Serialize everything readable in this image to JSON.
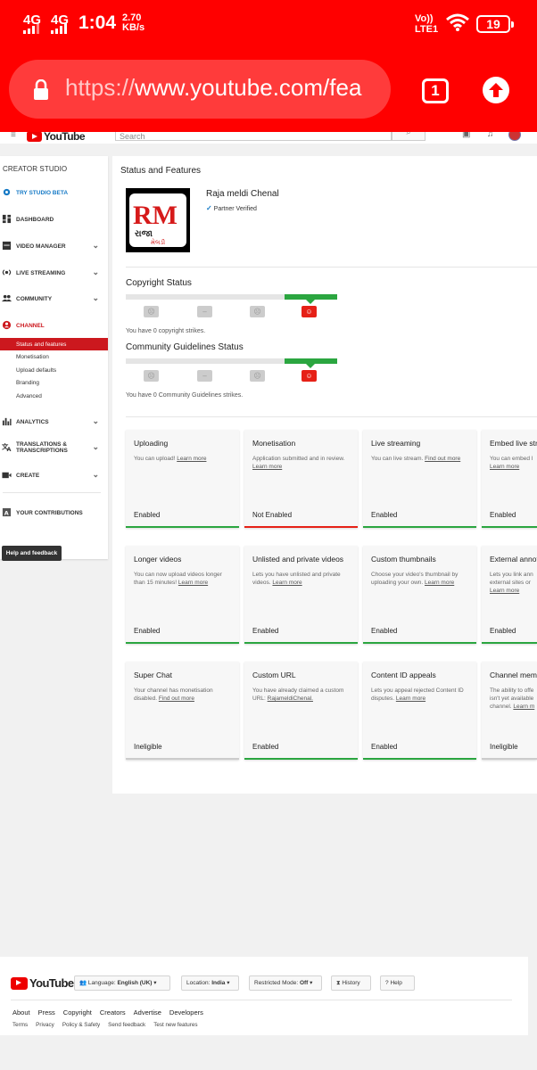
{
  "statusbar": {
    "net1": "4G",
    "net2": "4G",
    "time": "1:04",
    "speed_value": "2.70",
    "speed_unit": "KB/s",
    "volte": "Vo))",
    "lte": "LTE1",
    "battery": "19"
  },
  "browser": {
    "url_scheme": "https://",
    "url_rest": "www.youtube.com/fea",
    "tab_count": "1"
  },
  "header": {
    "logo": "YouTube",
    "search_placeholder": "Search"
  },
  "sidebar": {
    "title": "CREATOR STUDIO",
    "items": [
      {
        "label": "TRY STUDIO BETA",
        "icon": "gear-icon"
      },
      {
        "label": "DASHBOARD",
        "icon": "dashboard-icon"
      },
      {
        "label": "VIDEO MANAGER",
        "icon": "video-manager-icon"
      },
      {
        "label": "LIVE STREAMING",
        "icon": "live-icon"
      },
      {
        "label": "COMMUNITY",
        "icon": "people-icon"
      },
      {
        "label": "CHANNEL",
        "icon": "channel-icon"
      },
      {
        "label": "ANALYTICS",
        "icon": "analytics-icon"
      },
      {
        "label": "TRANSLATIONS &",
        "label2": "TRANSCRIPTIONS",
        "icon": "translate-icon"
      },
      {
        "label": "CREATE",
        "icon": "create-icon"
      },
      {
        "label": "YOUR CONTRIBUTIONS",
        "icon": "contributions-icon"
      }
    ],
    "channel_sub": [
      "Status and features",
      "Monetisation",
      "Upload defaults",
      "Branding",
      "Advanced"
    ],
    "help_button": "Help and feedback"
  },
  "main": {
    "title": "Status and Features",
    "channel_name": "Raja meldi Chenal",
    "partner": "Partner Verified",
    "logo_text": "RM",
    "logo_sub": "રાજા",
    "logo_sub2": "મેલડી",
    "copyright_title": "Copyright Status",
    "copyright_strikes": "You have 0 copyright strikes.",
    "guidelines_title": "Community Guidelines Status",
    "guidelines_strikes": "You have 0 Community Guidelines strikes.",
    "cards": [
      {
        "title": "Uploading",
        "desc": "You can upload!",
        "link": "Learn more",
        "status": "Enabled",
        "bar": "green"
      },
      {
        "title": "Monetisation",
        "desc": "Application submitted and in review.",
        "link": "Learn more",
        "status": "Not Enabled",
        "bar": "red"
      },
      {
        "title": "Live streaming",
        "desc": "You can live stream.",
        "link": "Find out more",
        "status": "Enabled",
        "bar": "green"
      },
      {
        "title": "Embed live stre",
        "desc": "You can embed l",
        "link": "Learn more",
        "status": "Enabled",
        "bar": "green"
      },
      {
        "title": "Longer videos",
        "desc": "You can now upload videos longer than 15 minutes!",
        "link": "Learn more",
        "status": "Enabled",
        "bar": "green"
      },
      {
        "title": "Unlisted and private videos",
        "desc": "Lets you have unlisted and private videos.",
        "link": "Learn more",
        "status": "Enabled",
        "bar": "green"
      },
      {
        "title": "Custom thumbnails",
        "desc": "Choose your video's thumbnail by uploading your own.",
        "link": "Learn more",
        "status": "Enabled",
        "bar": "green"
      },
      {
        "title": "External annot",
        "desc": "Lets you link ann external sites or",
        "link": "Learn more",
        "status": "Enabled",
        "bar": "green"
      },
      {
        "title": "Super Chat",
        "desc": "Your channel has monetisation disabled.",
        "link": "Find out more",
        "status": "Ineligible",
        "bar": "grey"
      },
      {
        "title": "Custom URL",
        "desc": "You have already claimed a custom URL:",
        "link": "RajameldiChenal.",
        "status": "Enabled",
        "bar": "green"
      },
      {
        "title": "Content ID appeals",
        "desc": "Lets you appeal rejected Content ID disputes.",
        "link": "Learn more",
        "status": "Enabled",
        "bar": "green"
      },
      {
        "title": "Channel memb",
        "desc": "The ability to offe isn't yet available channel.",
        "link": "Learn m",
        "status": "Ineligible",
        "bar": "grey"
      }
    ]
  },
  "footer": {
    "logo": "YouTube",
    "language_label": "Language:",
    "language_value": "English (UK)",
    "location_label": "Location:",
    "location_value": "India",
    "restricted_label": "Restricted Mode:",
    "restricted_value": "Off",
    "history": "History",
    "help": "Help",
    "links1": [
      "About",
      "Press",
      "Copyright",
      "Creators",
      "Advertise",
      "Developers"
    ],
    "links2": [
      "Terms",
      "Privacy",
      "Policy & Safety",
      "Send feedback",
      "Test new features"
    ]
  },
  "colors": {
    "brand_red": "#ff0000",
    "youtube_red": "#cc181e",
    "enabled_green": "#2ba640",
    "link_blue": "#167ac6"
  }
}
